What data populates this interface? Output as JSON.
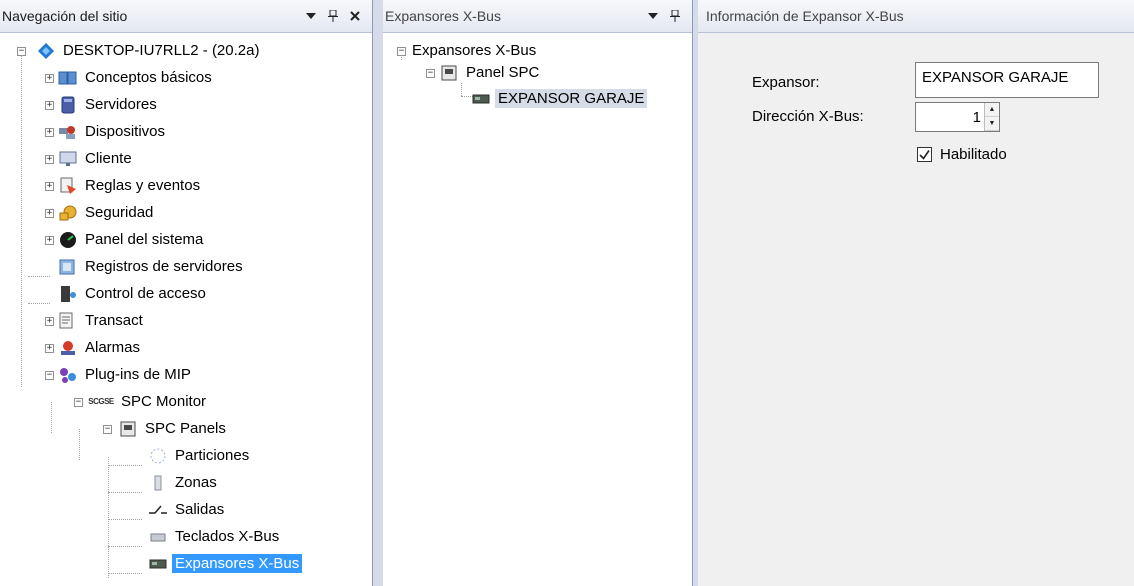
{
  "nav_pane": {
    "title": "Navegación del sitio",
    "root": "DESKTOP-IU7RLL2 - (20.2a)",
    "items": [
      {
        "label": "Conceptos básicos",
        "icon": "book-icon"
      },
      {
        "label": "Servidores",
        "icon": "server-icon"
      },
      {
        "label": "Dispositivos",
        "icon": "devices-icon"
      },
      {
        "label": "Cliente",
        "icon": "monitor-icon"
      },
      {
        "label": "Reglas y eventos",
        "icon": "rules-icon"
      },
      {
        "label": "Seguridad",
        "icon": "security-icon"
      },
      {
        "label": "Panel del sistema",
        "icon": "system-dashboard-icon"
      },
      {
        "label": "Registros de servidores",
        "icon": "server-logs-icon"
      },
      {
        "label": "Control de acceso",
        "icon": "access-control-icon"
      },
      {
        "label": "Transact",
        "icon": "transact-icon"
      },
      {
        "label": "Alarmas",
        "icon": "alarm-icon"
      },
      {
        "label": "Plug-ins de MIP",
        "icon": "plugin-icon"
      }
    ],
    "spc_monitor": {
      "label": "SPC Monitor",
      "icon_text": "SCGSE"
    },
    "spc_panels": "SPC Panels",
    "spc_children": [
      {
        "label": "Particiones",
        "icon": "partitions-icon"
      },
      {
        "label": "Zonas",
        "icon": "zones-icon"
      },
      {
        "label": "Salidas",
        "icon": "outputs-icon"
      },
      {
        "label": "Teclados X-Bus",
        "icon": "keypad-icon"
      },
      {
        "label": "Expansores X-Bus",
        "icon": "expander-icon"
      }
    ]
  },
  "xbus_pane": {
    "title": "Expansores X-Bus",
    "root": "Expansores X-Bus",
    "panel": "Panel SPC",
    "expander": "EXPANSOR GARAJE"
  },
  "info_pane": {
    "title": "Información de Expansor X-Bus",
    "expansor_label": "Expansor:",
    "expansor_value": "EXPANSOR GARAJE",
    "direccion_label": "Dirección X-Bus:",
    "direccion_value": "1",
    "habilitado_label": "Habilitado",
    "habilitado_checked": true
  },
  "colors": {
    "selection": "#3399ff",
    "header_bg": "#e4e8f1",
    "splitter": "#d6dbe9",
    "info_bg": "#f0f0f0"
  }
}
